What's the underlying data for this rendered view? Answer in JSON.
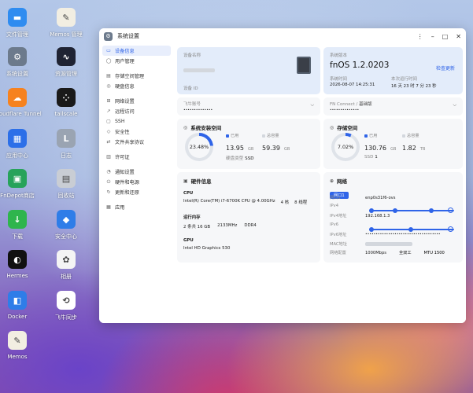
{
  "desktop": {
    "icons": [
      {
        "label": "文件管理",
        "icon": "folder-icon",
        "color": "#2f8cf0"
      },
      {
        "label": "Memos 管理",
        "icon": "memos-icon",
        "color": "#f2eee2"
      },
      {
        "label": "系统设置",
        "icon": "gear-icon",
        "color": "#6c7a8c"
      },
      {
        "label": "资源管理",
        "icon": "monitor-icon",
        "color": "#1f2333"
      },
      {
        "label": "Cloudflare Tunnel",
        "icon": "cloud-icon",
        "color": "#f6821f"
      },
      {
        "label": "tailscale",
        "icon": "tailscale-icon",
        "color": "#1a1a1a"
      },
      {
        "label": "应用中心",
        "icon": "store-icon",
        "color": "#2c6fe8"
      },
      {
        "label": "日志",
        "icon": "log-icon",
        "color": "#9aa4b2"
      },
      {
        "label": "FnDepot商店",
        "icon": "depot-icon",
        "color": "#27a35a"
      },
      {
        "label": "回收站",
        "icon": "trash-icon",
        "color": "#c9cdd4"
      },
      {
        "label": "下载",
        "icon": "download-icon",
        "color": "#2fb54d"
      },
      {
        "label": "安全中心",
        "icon": "shield-icon",
        "color": "#2f7de8"
      },
      {
        "label": "Hermes",
        "icon": "hermes-icon",
        "color": "#111111"
      },
      {
        "label": "相册",
        "icon": "photos-icon",
        "color": "#f4f4f4"
      },
      {
        "label": "Docker",
        "icon": "docker-icon",
        "color": "#2f7de8"
      },
      {
        "label": "飞牛同步",
        "icon": "sync-icon",
        "color": "#ffffff"
      },
      {
        "label": "Memos",
        "icon": "memos-icon",
        "color": "#f2eee2"
      }
    ]
  },
  "window": {
    "title": "系统设置",
    "controls": [
      "⋮",
      "–",
      "□",
      "✕"
    ]
  },
  "sidebar": {
    "items": [
      {
        "label": "设备信息",
        "icon": "info-icon",
        "active": true
      },
      {
        "label": "用户管理",
        "icon": "user-icon"
      },
      {
        "label": "存储空间管理",
        "icon": "storage-icon"
      },
      {
        "label": "硬盘信息",
        "icon": "disk-icon"
      },
      {
        "label": "网络设置",
        "icon": "network-icon"
      },
      {
        "label": "远程访问",
        "icon": "remote-icon"
      },
      {
        "label": "SSH",
        "icon": "terminal-icon"
      },
      {
        "label": "安全性",
        "icon": "shield-icon"
      },
      {
        "label": "文件共享协议",
        "icon": "share-icon"
      },
      {
        "label": "许可证",
        "icon": "license-icon"
      },
      {
        "label": "通知设置",
        "icon": "bell-icon"
      },
      {
        "label": "硬件和电源",
        "icon": "power-icon"
      },
      {
        "label": "更新和还原",
        "icon": "update-icon"
      },
      {
        "label": "应用",
        "icon": "apps-icon"
      }
    ]
  },
  "device": {
    "name_label": "设备名称",
    "id_label": "设备 ID"
  },
  "system": {
    "version_label": "系统版本",
    "version": "fnOS 1.2.0203",
    "check_update": "检查更新",
    "time_label": "系统时间",
    "time": "2026-08-07 14:25:31",
    "uptime_label": "本次运行时间",
    "uptime": "16 天 23 时 7 分 23 秒"
  },
  "feiniu": {
    "label": "飞牛账号",
    "value": "••••••••••••••"
  },
  "fnconnect": {
    "label": "FN Connect",
    "sep": "/",
    "sub": "基础版",
    "value": "••••••••••••••"
  },
  "sys_space": {
    "title": "系统安装空间",
    "percent": "23.48%",
    "percent_value": 23.48,
    "used_label": "已用",
    "used": "13.95",
    "used_unit": "GB",
    "total_label": "总容量",
    "total": "59.39",
    "total_unit": "GB",
    "disk_type_label": "硬盘类型",
    "disk_type": "SSD"
  },
  "storage": {
    "title": "存储空间",
    "percent": "7.02%",
    "percent_value": 7.02,
    "used_label": "已用",
    "used": "130.76",
    "used_unit": "GB",
    "total_label": "总容量",
    "total": "1.82",
    "total_unit": "TB",
    "ssd_label": "SSD",
    "ssd": "1"
  },
  "hardware": {
    "title": "硬件信息",
    "cpu_label": "CPU",
    "cpu": "Intel(R) Core(TM) i7-6700K CPU @ 4.00GHz",
    "cores": "4 核",
    "threads": "8 线程",
    "mem_label": "运行内存",
    "mem_size": "2 条共 16 GB",
    "mem_speed": "2133MHz",
    "mem_type": "DDR4",
    "gpu_label": "GPU",
    "gpu": "Intel HD Graphics 530"
  },
  "network": {
    "title": "网络",
    "tab": "网口1",
    "rows": [
      {
        "k": "网口1",
        "v": "enp0s31f6-ovs"
      },
      {
        "k": "IPv4",
        "v": ""
      },
      {
        "k": "IPv4地址",
        "v": "192.168.1.3"
      },
      {
        "k": "IPv6",
        "v": ""
      },
      {
        "k": "IPv6地址",
        "v": "••••••••••••••••••••••••••••••••••••"
      },
      {
        "k": "MAC地址",
        "v": ""
      },
      {
        "k": "网络配置",
        "v": "1000Mbps"
      }
    ],
    "duplex": "全双工",
    "mtu": "MTU 1500"
  }
}
